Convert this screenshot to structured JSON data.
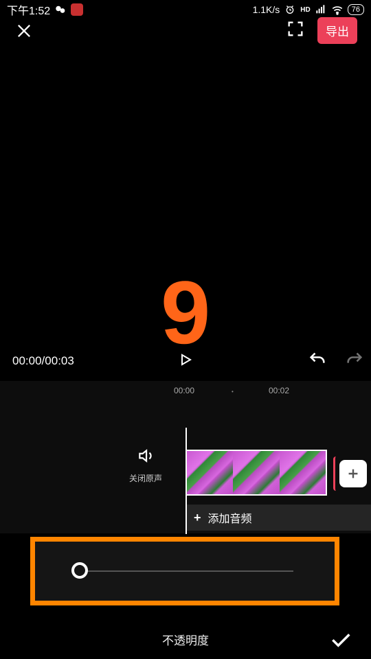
{
  "statusBar": {
    "time": "下午1:52",
    "netSpeed": "1.1K/s",
    "hdLabel": "HD",
    "battery": "76"
  },
  "header": {
    "exportLabel": "导出"
  },
  "overlayNumber": "9",
  "playback": {
    "currentTime": "00:00",
    "totalTime": "00:03",
    "separator": "/"
  },
  "timeline": {
    "ruler": [
      "00:00",
      "00:02"
    ],
    "muteLabel": "关闭原声",
    "addAudioLabel": "添加音频",
    "addAudioPlus": "+"
  },
  "bottom": {
    "opacityLabel": "不透明度"
  }
}
